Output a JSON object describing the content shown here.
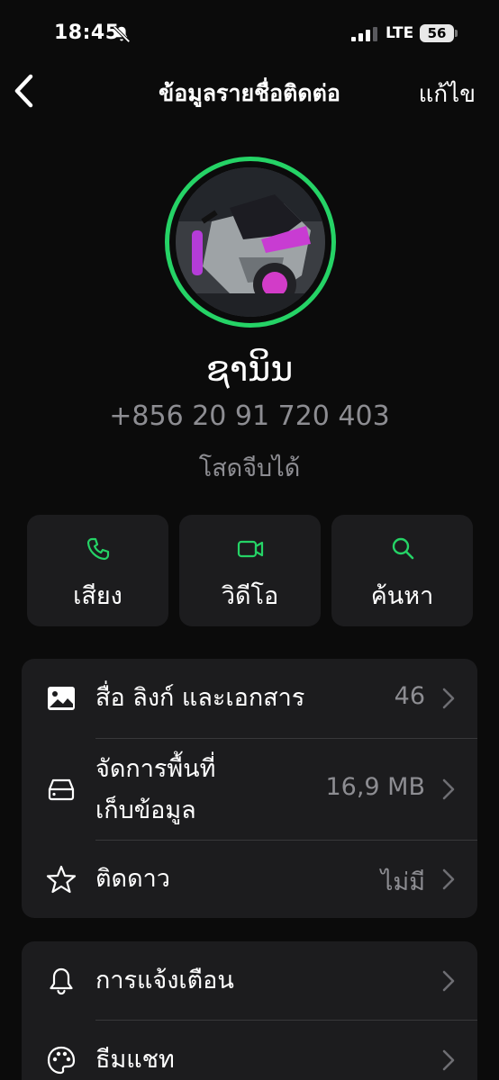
{
  "status_bar": {
    "time": "18:45",
    "network": "LTE",
    "battery": "56",
    "icons": [
      "bell-slash-icon",
      "signal-bars-icon",
      "battery-icon"
    ]
  },
  "nav": {
    "title": "ข้อมูลรายชื่อติดต่อ",
    "edit_label": "แก้ไข",
    "back_icon": "chevron-left-icon"
  },
  "profile": {
    "name": "ຊານິນ",
    "phone": "+856 20 91 720 403",
    "status": "โสดจีบได้",
    "ring_color": "#25d366"
  },
  "actions": [
    {
      "label": "เสียง",
      "icon": "phone-icon"
    },
    {
      "label": "วิดีโอ",
      "icon": "video-camera-icon"
    },
    {
      "label": "ค้นหา",
      "icon": "search-icon"
    }
  ],
  "accent_color": "#25d366",
  "info_group": [
    {
      "label": "สื่อ ลิงก์ และเอกสาร",
      "value": "46",
      "icon": "image-icon"
    },
    {
      "label_line1": "จัดการพื้นที่",
      "label_line2": "เก็บข้อมูล",
      "value": "16,9 MB",
      "icon": "storage-drive-icon"
    },
    {
      "label": "ติดดาว",
      "value": "ไม่มี",
      "icon": "star-icon"
    }
  ],
  "settings_group": [
    {
      "label": "การแจ้งเตือน",
      "icon": "bell-icon"
    },
    {
      "label": "ธีมแชท",
      "icon": "palette-icon"
    }
  ]
}
